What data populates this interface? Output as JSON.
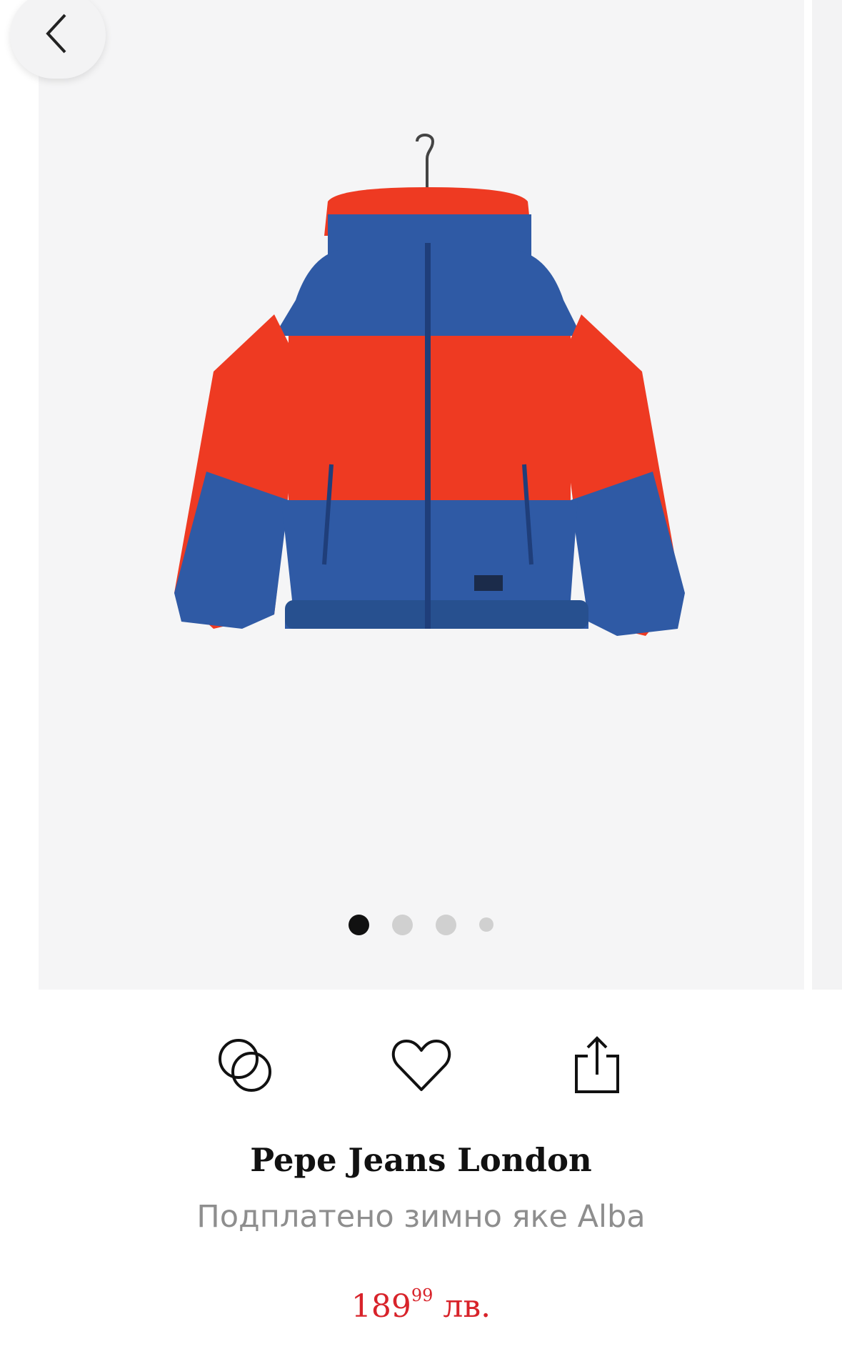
{
  "gallery": {
    "back_icon": "chevron-left-icon",
    "image_alt": "Red and blue puffer jacket on hanger",
    "dots_count": 4,
    "active_dot": 0
  },
  "actions": {
    "compare_icon": "compare-circles-icon",
    "wishlist_icon": "heart-icon",
    "share_icon": "share-icon"
  },
  "product": {
    "brand": "Pepe Jeans London",
    "name": "Подплатено зимно яке Alba",
    "price_main": "189",
    "price_cents": "99",
    "currency": "лв."
  },
  "colors": {
    "price": "#d8232a",
    "subtitle": "#8e8e8e",
    "jacket_red": "#ee3a22",
    "jacket_blue": "#2f5aa5"
  }
}
